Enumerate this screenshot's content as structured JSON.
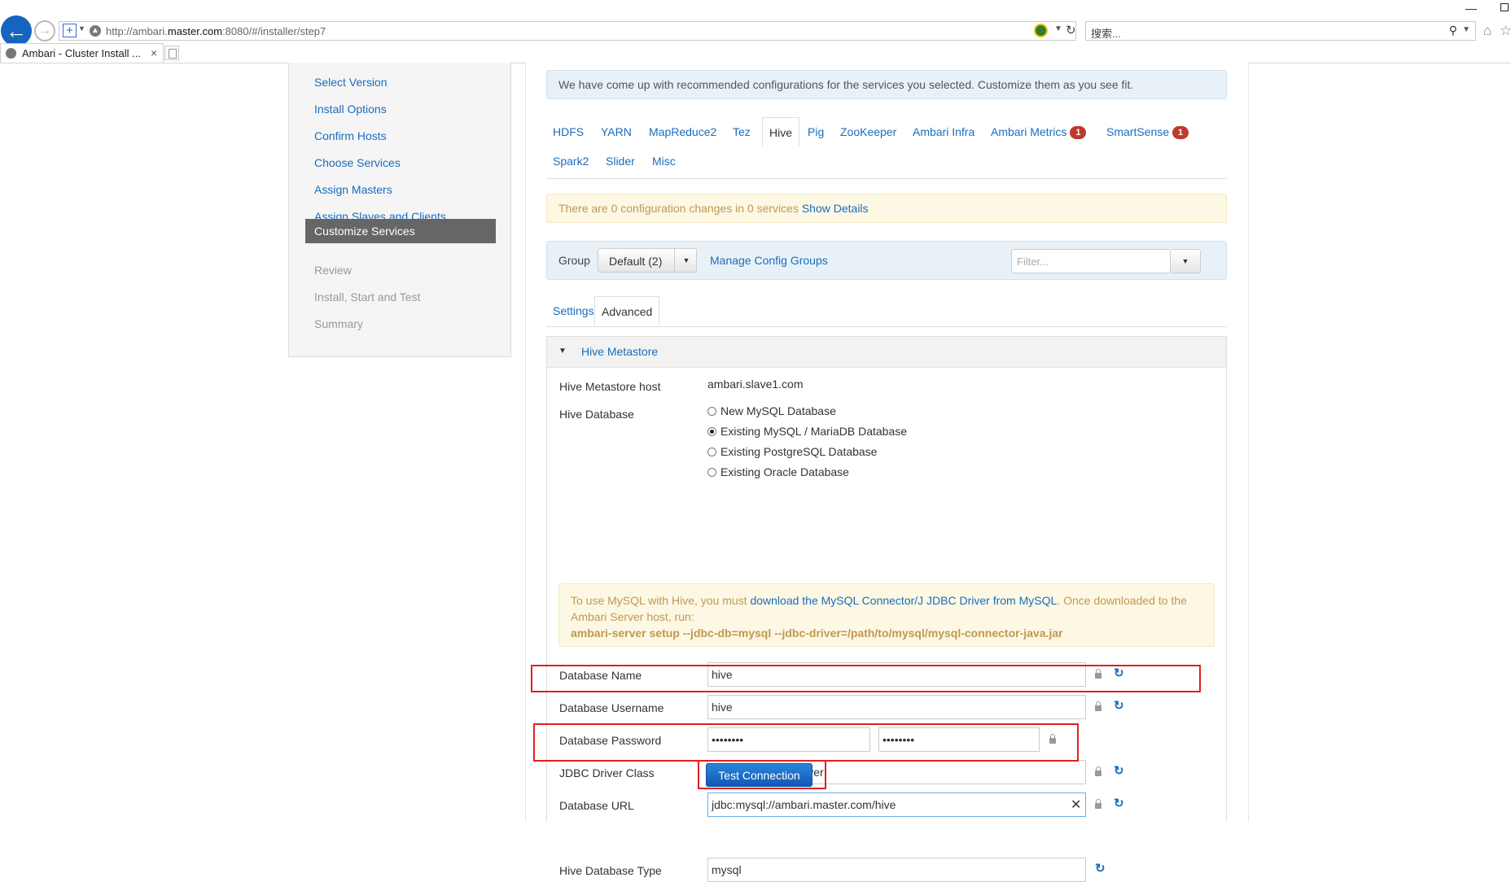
{
  "browser": {
    "url_prefix": "http://ambari.",
    "url_host": "master.com",
    "url_suffix": ":8080/#/installer/step7",
    "search_placeholder": "搜索...",
    "tab_title": "Ambari - Cluster Install ..."
  },
  "wizard": {
    "steps": [
      {
        "label": "Select Version",
        "state": "done"
      },
      {
        "label": "Install Options",
        "state": "done"
      },
      {
        "label": "Confirm Hosts",
        "state": "done"
      },
      {
        "label": "Choose Services",
        "state": "done"
      },
      {
        "label": "Assign Masters",
        "state": "done"
      },
      {
        "label": "Assign Slaves and Clients",
        "state": "done"
      },
      {
        "label": "Customize Services",
        "state": "active"
      },
      {
        "label": "Review",
        "state": "todo"
      },
      {
        "label": "Install, Start and Test",
        "state": "todo"
      },
      {
        "label": "Summary",
        "state": "todo"
      }
    ]
  },
  "banner": "We have come up with recommended configurations for the services you selected. Customize them as you see fit.",
  "service_tabs": {
    "hdfs": "HDFS",
    "yarn": "YARN",
    "mapreduce2": "MapReduce2",
    "tez": "Tez",
    "hive": "Hive",
    "pig": "Pig",
    "zookeeper": "ZooKeeper",
    "ambari_infra": "Ambari Infra",
    "ambari_metrics": "Ambari Metrics",
    "ambari_metrics_badge": "1",
    "smartsense": "SmartSense",
    "smartsense_badge": "1",
    "spark2": "Spark2",
    "slider": "Slider",
    "misc": "Misc",
    "active": "Hive"
  },
  "changes_bar": {
    "text": "There are 0 configuration changes in 0 services",
    "link": "Show Details"
  },
  "group_bar": {
    "label": "Group",
    "selected": "Default (2)",
    "manage_link": "Manage Config Groups",
    "filter_placeholder": "Filter..."
  },
  "sub_tabs": {
    "settings": "Settings",
    "advanced": "Advanced",
    "active": "Advanced"
  },
  "section": {
    "title": "Hive Metastore",
    "metastore_host_label": "Hive Metastore host",
    "metastore_host_value": "ambari.slave1.com",
    "database_label": "Hive Database",
    "db_options": [
      {
        "label": "New MySQL Database",
        "checked": false
      },
      {
        "label": "Existing MySQL / MariaDB Database",
        "checked": true
      },
      {
        "label": "Existing PostgreSQL Database",
        "checked": false
      },
      {
        "label": "Existing Oracle Database",
        "checked": false
      }
    ],
    "warning": {
      "pre": "To use MySQL with Hive, you must ",
      "link": "download the MySQL Connector/J JDBC Driver from MySQL",
      "post": ". Once downloaded to the Ambari Server host, run:",
      "command": "ambari-server setup --jdbc-db=mysql --jdbc-driver=/path/to/mysql/mysql-connector-java.jar"
    },
    "fields": {
      "db_name_label": "Database Name",
      "db_name_value": "hive",
      "db_user_label": "Database Username",
      "db_user_value": "hive",
      "db_password_label": "Database Password",
      "db_password_value": "hivepass",
      "db_password_confirm_value": "hivepass",
      "jdbc_driver_label": "JDBC Driver Class",
      "jdbc_driver_value": "com.mysql.jdbc.Driver",
      "db_url_label": "Database URL",
      "db_url_value": "jdbc:mysql://ambari.master.com/hive",
      "test_connection_label": "Test Connection",
      "db_type_label": "Hive Database Type",
      "db_type_value": "mysql"
    }
  },
  "colors": {
    "link": "#1a6dbd",
    "active_step": "#666666",
    "badge": "#c0392b",
    "highlight": "#e02020",
    "primary_button": "#1a6dd0"
  }
}
